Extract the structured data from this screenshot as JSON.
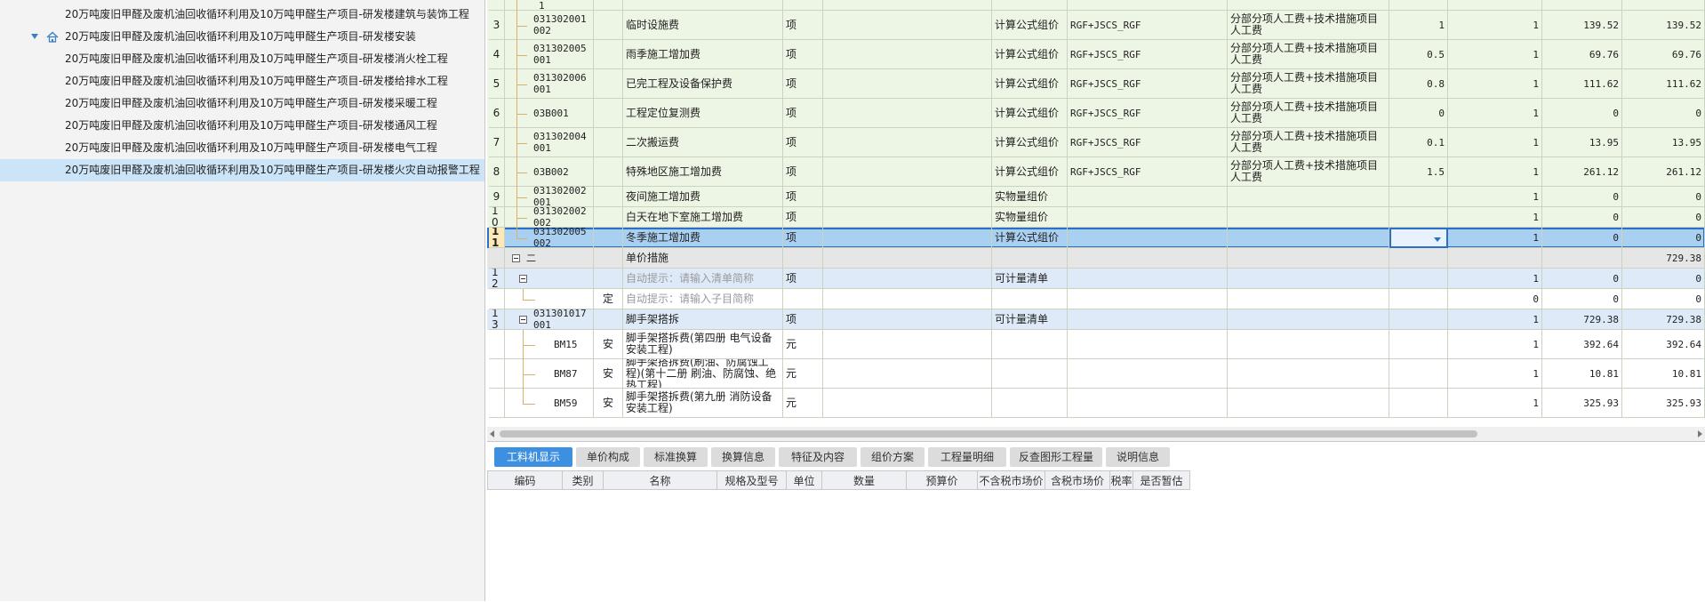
{
  "tree": {
    "items": [
      {
        "label": "20万吨废旧甲醛及废机油回收循环利用及10万吨甲醛生产项目-研发楼建筑与装饰工程",
        "level": 2
      },
      {
        "label": "20万吨废旧甲醛及废机油回收循环利用及10万吨甲醛生产项目-研发楼安装",
        "level": 1
      },
      {
        "label": "20万吨废旧甲醛及废机油回收循环利用及10万吨甲醛生产项目-研发楼消火栓工程",
        "level": 2
      },
      {
        "label": "20万吨废旧甲醛及废机油回收循环利用及10万吨甲醛生产项目-研发楼给排水工程",
        "level": 2
      },
      {
        "label": "20万吨废旧甲醛及废机油回收循环利用及10万吨甲醛生产项目-研发楼采暖工程",
        "level": 2
      },
      {
        "label": "20万吨废旧甲醛及废机油回收循环利用及10万吨甲醛生产项目-研发楼通风工程",
        "level": 2
      },
      {
        "label": "20万吨废旧甲醛及废机油回收循环利用及10万吨甲醛生产项目-研发楼电气工程",
        "level": 2
      },
      {
        "label": "20万吨废旧甲醛及废机油回收循环利用及10万吨甲醛生产项目-研发楼火灾自动报警工程",
        "level": 2
      }
    ]
  },
  "grid": {
    "top_fragment": "1",
    "rows": [
      {
        "no": "3",
        "code": "031302001002",
        "type": "",
        "name": "临时设施费",
        "unit": "项",
        "method": "计算公式组价",
        "formula": "RGF+JSCS_RGF",
        "basis": "分部分项人工费+技术措施项目人工费",
        "rate": "1",
        "qty": "1",
        "price": "139.52",
        "total": "139.52"
      },
      {
        "no": "4",
        "code": "031302005001",
        "type": "",
        "name": "雨季施工增加费",
        "unit": "项",
        "method": "计算公式组价",
        "formula": "RGF+JSCS_RGF",
        "basis": "分部分项人工费+技术措施项目人工费",
        "rate": "0.5",
        "qty": "1",
        "price": "69.76",
        "total": "69.76"
      },
      {
        "no": "5",
        "code": "031302006001",
        "type": "",
        "name": "已完工程及设备保护费",
        "unit": "项",
        "method": "计算公式组价",
        "formula": "RGF+JSCS_RGF",
        "basis": "分部分项人工费+技术措施项目人工费",
        "rate": "0.8",
        "qty": "1",
        "price": "111.62",
        "total": "111.62"
      },
      {
        "no": "6",
        "code": "03B001",
        "type": "",
        "name": "工程定位复测费",
        "unit": "项",
        "method": "计算公式组价",
        "formula": "RGF+JSCS_RGF",
        "basis": "分部分项人工费+技术措施项目人工费",
        "rate": "0",
        "qty": "1",
        "price": "0",
        "total": "0"
      },
      {
        "no": "7",
        "code": "031302004001",
        "type": "",
        "name": "二次搬运费",
        "unit": "项",
        "method": "计算公式组价",
        "formula": "RGF+JSCS_RGF",
        "basis": "分部分项人工费+技术措施项目人工费",
        "rate": "0.1",
        "qty": "1",
        "price": "13.95",
        "total": "13.95"
      },
      {
        "no": "8",
        "code": "03B002",
        "type": "",
        "name": "特殊地区施工增加费",
        "unit": "项",
        "method": "计算公式组价",
        "formula": "RGF+JSCS_RGF",
        "basis": "分部分项人工费+技术措施项目人工费",
        "rate": "1.5",
        "qty": "1",
        "price": "261.12",
        "total": "261.12"
      },
      {
        "no": "9",
        "code": "031302002001",
        "type": "",
        "name": "夜间施工增加费",
        "unit": "项",
        "method": "实物量组价",
        "formula": "",
        "basis": "",
        "rate": "",
        "qty": "1",
        "price": "0",
        "total": "0"
      },
      {
        "no": "10",
        "code": "031302002002",
        "type": "",
        "name": "白天在地下室施工增加费",
        "unit": "项",
        "method": "实物量组价",
        "formula": "",
        "basis": "",
        "rate": "",
        "qty": "1",
        "price": "0",
        "total": "0"
      },
      {
        "no": "11",
        "code": "031302005002",
        "type": "",
        "name": "冬季施工增加费",
        "unit": "项",
        "method": "计算公式组价",
        "formula": "",
        "basis": "",
        "rate": "",
        "qty": "1",
        "price": "0",
        "total": "0"
      },
      {
        "no": "",
        "code": "二",
        "type": "",
        "name": "单价措施",
        "unit": "",
        "method": "",
        "formula": "",
        "basis": "",
        "rate": "",
        "qty": "",
        "price": "",
        "total": "729.38"
      },
      {
        "no": "12",
        "code": "",
        "type": "",
        "name": "自动提示：请输入清单简称",
        "unit": "项",
        "method": "可计量清单",
        "formula": "",
        "basis": "",
        "rate": "",
        "qty": "1",
        "price": "0",
        "total": "0"
      },
      {
        "no": "",
        "code": "",
        "type": "定",
        "name": "自动提示：请输入子目简称",
        "unit": "",
        "method": "",
        "formula": "",
        "basis": "",
        "rate": "",
        "qty": "0",
        "price": "0",
        "total": "0"
      },
      {
        "no": "13",
        "code": "031301017001",
        "type": "",
        "name": "脚手架搭拆",
        "unit": "项",
        "method": "可计量清单",
        "formula": "",
        "basis": "",
        "rate": "",
        "qty": "1",
        "price": "729.38",
        "total": "729.38"
      },
      {
        "no": "",
        "code": "BM15",
        "type": "安",
        "name": "脚手架搭拆费(第四册 电气设备安装工程)",
        "unit": "元",
        "method": "",
        "formula": "",
        "basis": "",
        "rate": "",
        "qty": "1",
        "price": "392.64",
        "total": "392.64"
      },
      {
        "no": "",
        "code": "BM87",
        "type": "安",
        "name": "脚手架搭拆费(刷油、防腐蚀工程)(第十二册 刷油、防腐蚀、绝热工程)",
        "unit": "元",
        "method": "",
        "formula": "",
        "basis": "",
        "rate": "",
        "qty": "1",
        "price": "10.81",
        "total": "10.81"
      },
      {
        "no": "",
        "code": "BM59",
        "type": "安",
        "name": "脚手架搭拆费(第九册 消防设备安装工程)",
        "unit": "元",
        "method": "",
        "formula": "",
        "basis": "",
        "rate": "",
        "qty": "1",
        "price": "325.93",
        "total": "325.93"
      }
    ]
  },
  "bottom": {
    "tabs": [
      "工料机显示",
      "单价构成",
      "标准换算",
      "换算信息",
      "特征及内容",
      "组价方案",
      "工程量明细",
      "反查图形工程量",
      "说明信息"
    ],
    "active_tab": 0,
    "columns": [
      "编码",
      "类别",
      "名称",
      "规格及型号",
      "单位",
      "数量",
      "预算价",
      "不含税市场价",
      "含税市场价",
      "税率",
      "是否暂估"
    ]
  },
  "colors": {
    "accent": "#3d8fe0",
    "selected_row": "#a9d0f1",
    "green_row": "#edf5e4",
    "blue_row": "#dfeaf8"
  },
  "icons": {
    "expand": "chevron-down-icon",
    "home": "home-icon",
    "collapse": "minus-box-icon"
  }
}
